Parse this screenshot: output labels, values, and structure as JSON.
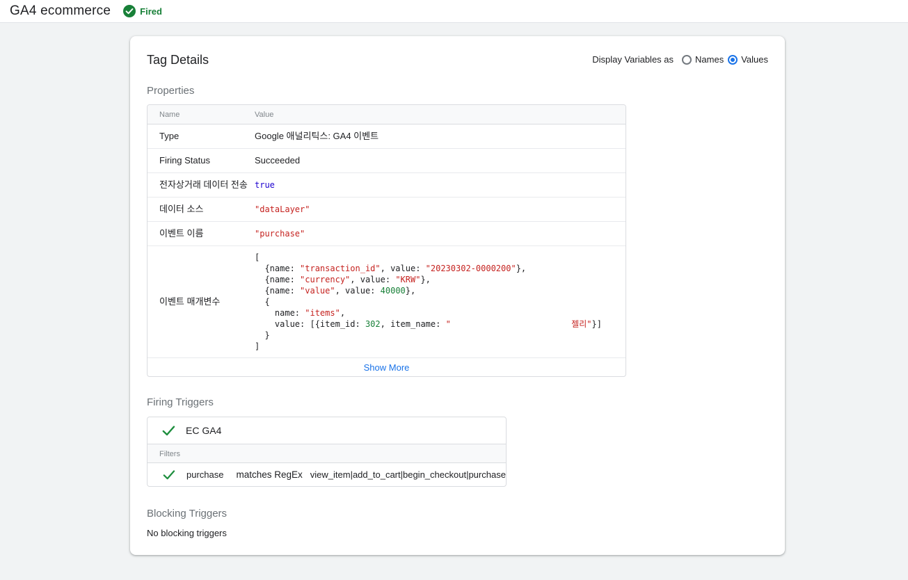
{
  "header": {
    "title": "GA4 ecommerce",
    "status": "Fired"
  },
  "colors": {
    "accent_blue": "#1a73e8",
    "success_green": "#188038",
    "code_string_red": "#c5221f",
    "code_bool_blue": "#1c00cf",
    "code_number_green": "#188038"
  },
  "icons": {
    "fired": "check-circle-icon",
    "trigger": "check-icon"
  },
  "card": {
    "title": "Tag Details",
    "display_variables": {
      "label": "Display Variables as",
      "options": [
        {
          "label": "Names",
          "selected": false
        },
        {
          "label": "Values",
          "selected": true
        }
      ]
    }
  },
  "properties": {
    "label": "Properties",
    "columns": [
      "Name",
      "Value"
    ],
    "rows": [
      {
        "name": "Type",
        "mono": false,
        "lines": [
          [
            {
              "t": "Google 애널리틱스: GA4 이벤트",
              "c": "plain"
            }
          ]
        ]
      },
      {
        "name": "Firing Status",
        "mono": false,
        "lines": [
          [
            {
              "t": "Succeeded",
              "c": "plain"
            }
          ]
        ]
      },
      {
        "name": "전자상거래 데이터 전송",
        "mono": true,
        "lines": [
          [
            {
              "t": "true",
              "c": "bool"
            }
          ]
        ]
      },
      {
        "name": "데이터 소스",
        "mono": true,
        "lines": [
          [
            {
              "t": "\"dataLayer\"",
              "c": "str"
            }
          ]
        ]
      },
      {
        "name": "이벤트 이름",
        "mono": true,
        "lines": [
          [
            {
              "t": "\"purchase\"",
              "c": "str"
            }
          ]
        ]
      },
      {
        "name": "이벤트 매개변수",
        "mono": true,
        "lines": [
          [
            {
              "t": "[",
              "c": "plain"
            }
          ],
          [
            {
              "t": "  {name: ",
              "c": "plain"
            },
            {
              "t": "\"transaction_id\"",
              "c": "str"
            },
            {
              "t": ", value: ",
              "c": "plain"
            },
            {
              "t": "\"20230302-0000200\"",
              "c": "str"
            },
            {
              "t": "},",
              "c": "plain"
            }
          ],
          [
            {
              "t": "  {name: ",
              "c": "plain"
            },
            {
              "t": "\"currency\"",
              "c": "str"
            },
            {
              "t": ", value: ",
              "c": "plain"
            },
            {
              "t": "\"KRW\"",
              "c": "str"
            },
            {
              "t": "},",
              "c": "plain"
            }
          ],
          [
            {
              "t": "  {name: ",
              "c": "plain"
            },
            {
              "t": "\"value\"",
              "c": "str"
            },
            {
              "t": ", value: ",
              "c": "plain"
            },
            {
              "t": "40000",
              "c": "num"
            },
            {
              "t": "},",
              "c": "plain"
            }
          ],
          [
            {
              "t": "  {",
              "c": "plain"
            }
          ],
          [
            {
              "t": "    name: ",
              "c": "plain"
            },
            {
              "t": "\"items\"",
              "c": "str"
            },
            {
              "t": ",",
              "c": "plain"
            }
          ],
          [
            {
              "t": "    value: [{item_id: ",
              "c": "plain"
            },
            {
              "t": "302",
              "c": "num"
            },
            {
              "t": ", item_name: ",
              "c": "plain"
            },
            {
              "t": "\"                        젤리\"",
              "c": "str"
            },
            {
              "t": "}]",
              "c": "plain"
            }
          ],
          [
            {
              "t": "  }",
              "c": "plain"
            }
          ],
          [
            {
              "t": "]",
              "c": "plain"
            }
          ]
        ]
      }
    ],
    "show_more": "Show More"
  },
  "firing_triggers": {
    "label": "Firing Triggers",
    "trigger_name": "EC GA4",
    "filters_label": "Filters",
    "filter": {
      "variable": "purchase",
      "operator": "matches RegEx",
      "value": "view_item|add_to_cart|begin_checkout|purchase"
    }
  },
  "blocking_triggers": {
    "label": "Blocking Triggers",
    "empty_text": "No blocking triggers"
  }
}
